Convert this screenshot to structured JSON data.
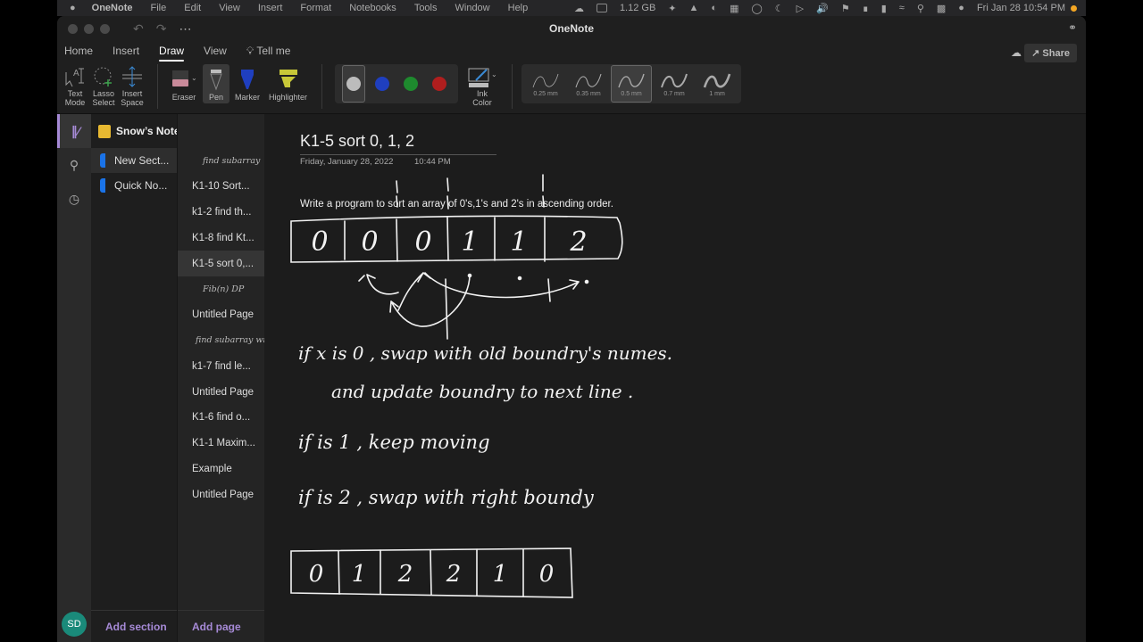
{
  "menubar": {
    "app": "OneNote",
    "items": [
      "File",
      "Edit",
      "View",
      "Insert",
      "Format",
      "Notebooks",
      "Tools",
      "Window",
      "Help"
    ],
    "memory": "1.12 GB",
    "clock": "Fri Jan 28  10:54 PM"
  },
  "window": {
    "title": "OneNote"
  },
  "tabs": [
    "Home",
    "Insert",
    "Draw",
    "View",
    "Tell me"
  ],
  "share_label": "Share",
  "ribbon": {
    "text_mode": "Text Mode",
    "lasso": "Lasso Select",
    "insert_space": "Insert Space",
    "eraser": "Eraser",
    "pen": "Pen",
    "marker": "Marker",
    "highlighter": "Highlighter",
    "ink_color": "Ink Color",
    "colors": [
      "#bcbcbc",
      "#1f3fbf",
      "#1e8a2e",
      "#b01e1e"
    ],
    "widths": [
      "0.25 mm",
      "0.35 mm",
      "0.5 mm",
      "0.7 mm",
      "1 mm"
    ]
  },
  "notebook": {
    "name": "Snow’s Notebook"
  },
  "sections": [
    "New Sect...",
    "Quick No..."
  ],
  "pages": [
    {
      "label": "find subarray",
      "ink": true
    },
    {
      "label": "K1-10 Sort...",
      "ink": false
    },
    {
      "label": "k1-2 find th...",
      "ink": false
    },
    {
      "label": "K1-8 find Kt...",
      "ink": false
    },
    {
      "label": "K1-5 sort 0,...",
      "ink": false,
      "active": true
    },
    {
      "label": "Fib(n) DP",
      "ink": true
    },
    {
      "label": "Untitled Page",
      "ink": false
    },
    {
      "label": "find subarray with",
      "ink": true
    },
    {
      "label": "k1-7 find le...",
      "ink": false
    },
    {
      "label": "Untitled Page",
      "ink": false
    },
    {
      "label": "K1-6 find o...",
      "ink": false
    },
    {
      "label": "K1-1 Maxim...",
      "ink": false
    },
    {
      "label": "Example",
      "ink": false
    },
    {
      "label": "Untitled Page",
      "ink": false
    }
  ],
  "add_section": "Add section",
  "add_page": "Add page",
  "avatar": "SD",
  "page": {
    "title": "K1-5 sort 0, 1, 2",
    "date": "Friday, January 28, 2022",
    "time": "10:44 PM",
    "prompt": "Write a program to sort an array of 0's,1's and 2's in ascending order.",
    "ink": {
      "array1": [
        "0",
        "0",
        "0",
        "1",
        "1",
        "2"
      ],
      "notes": [
        "if x is 0 ,  swap with old boundry's numes.",
        "and update boundry to next line .",
        "if  is  1 ,  keep moving",
        "if is 2 ,   swap with right boundy"
      ],
      "array2": [
        "0",
        "1",
        "2",
        "2",
        "1",
        "0"
      ]
    }
  }
}
